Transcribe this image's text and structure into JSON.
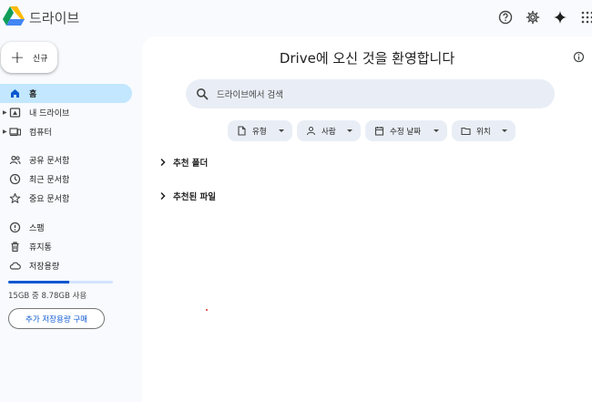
{
  "app": {
    "name": "드라이브"
  },
  "sidebar": {
    "new_label": "신규",
    "items": [
      {
        "label": "홈",
        "icon": "home-icon",
        "active": true
      },
      {
        "label": "내 드라이브",
        "icon": "my-drive-icon"
      },
      {
        "label": "컴퓨터",
        "icon": "computers-icon"
      },
      {
        "label": "공유 문서함",
        "icon": "shared-icon"
      },
      {
        "label": "최근 문서함",
        "icon": "clock-icon"
      },
      {
        "label": "중요 문서함",
        "icon": "star-icon"
      },
      {
        "label": "스팸",
        "icon": "spam-icon"
      },
      {
        "label": "휴지통",
        "icon": "trash-icon"
      },
      {
        "label": "저장용량",
        "icon": "cloud-icon"
      }
    ],
    "storage": {
      "used_fraction": 0.585,
      "text": "15GB 중 8.78GB 사용"
    },
    "buy_label": "추가 저장용량 구매"
  },
  "main": {
    "welcome": "Drive에 오신 것을 환영합니다",
    "search_placeholder": "드라이브에서 검색",
    "filters": [
      "유형",
      "사람",
      "수정 날짜",
      "위치"
    ],
    "sections": [
      "추천 폴더",
      "추천된 파일"
    ]
  },
  "colors": {
    "accent": "#0b57d0",
    "active_bg": "#c2e7ff",
    "chip_bg": "#e9eef6"
  }
}
